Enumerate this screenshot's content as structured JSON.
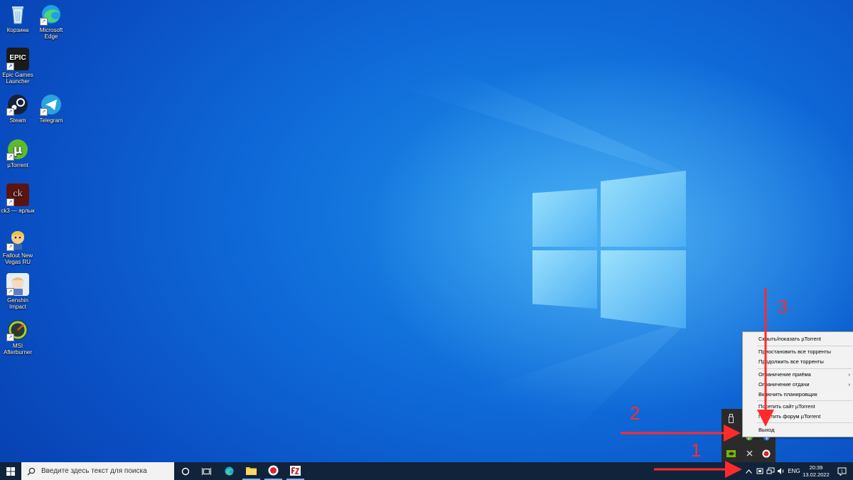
{
  "desktop_icons": [
    {
      "id": "recycle-bin",
      "label": "Корзина",
      "icon": "recycle-bin-icon"
    },
    {
      "id": "edge",
      "label": "Microsoft Edge",
      "icon": "edge-icon"
    },
    {
      "id": "epic",
      "label": "Epic Games Launcher",
      "icon": "epic-games-icon",
      "logo_text": "EPIC"
    },
    {
      "id": "steam",
      "label": "Steam",
      "icon": "steam-icon"
    },
    {
      "id": "telegram",
      "label": "Telegram",
      "icon": "telegram-icon"
    },
    {
      "id": "utorrent",
      "label": "µTorrent",
      "icon": "utorrent-icon"
    },
    {
      "id": "ck3",
      "label": "ck3 — ярлык",
      "icon": "ck3-icon",
      "logo_text": "ck"
    },
    {
      "id": "fallout",
      "label": "Fallout New Vegas RU",
      "icon": "fallout-icon"
    },
    {
      "id": "genshin",
      "label": "Genshin Impact",
      "icon": "genshin-icon"
    },
    {
      "id": "msi",
      "label": "MSI Afterburner",
      "icon": "msi-afterburner-icon"
    }
  ],
  "taskbar": {
    "search_placeholder": "Введите здесь текст для поиска",
    "language": "ENG",
    "time": "20:39",
    "date": "13.02.2022",
    "notification_count": "1",
    "pinned_apps": [
      "cortana-icon",
      "task-view-icon",
      "edge-icon",
      "file-explorer-icon",
      "record-icon",
      "filezilla-icon"
    ]
  },
  "tray_popup_icons": [
    "usb-icon",
    "utorrent-tray-icon",
    "bluetooth-icon",
    "nvidia-icon",
    "cursor-icon",
    "record-icon"
  ],
  "context_menu": {
    "items": [
      {
        "label": "Скрыть/показать µTorrent",
        "submenu": false
      },
      {
        "label": "Приостановить все торренты",
        "submenu": false
      },
      {
        "label": "Продолжить все торренты",
        "submenu": false
      },
      {
        "label": "Ограничение приёма",
        "submenu": true
      },
      {
        "label": "Ограничение отдачи",
        "submenu": true
      },
      {
        "label": "Включить планировщик",
        "submenu": false
      },
      {
        "label": "Посетить сайт µTorrent",
        "submenu": false
      },
      {
        "label": "Посетить форум µTorrent",
        "submenu": false
      },
      {
        "label": "Выход",
        "submenu": false
      }
    ]
  },
  "annotations": {
    "step1": "1",
    "step2": "2",
    "step3": "3",
    "color": "#ff2b2b"
  },
  "colors": {
    "taskbar": "#10233b",
    "desktop_accent": "#0a63d6",
    "menu_bg": "#f2f2f2"
  }
}
